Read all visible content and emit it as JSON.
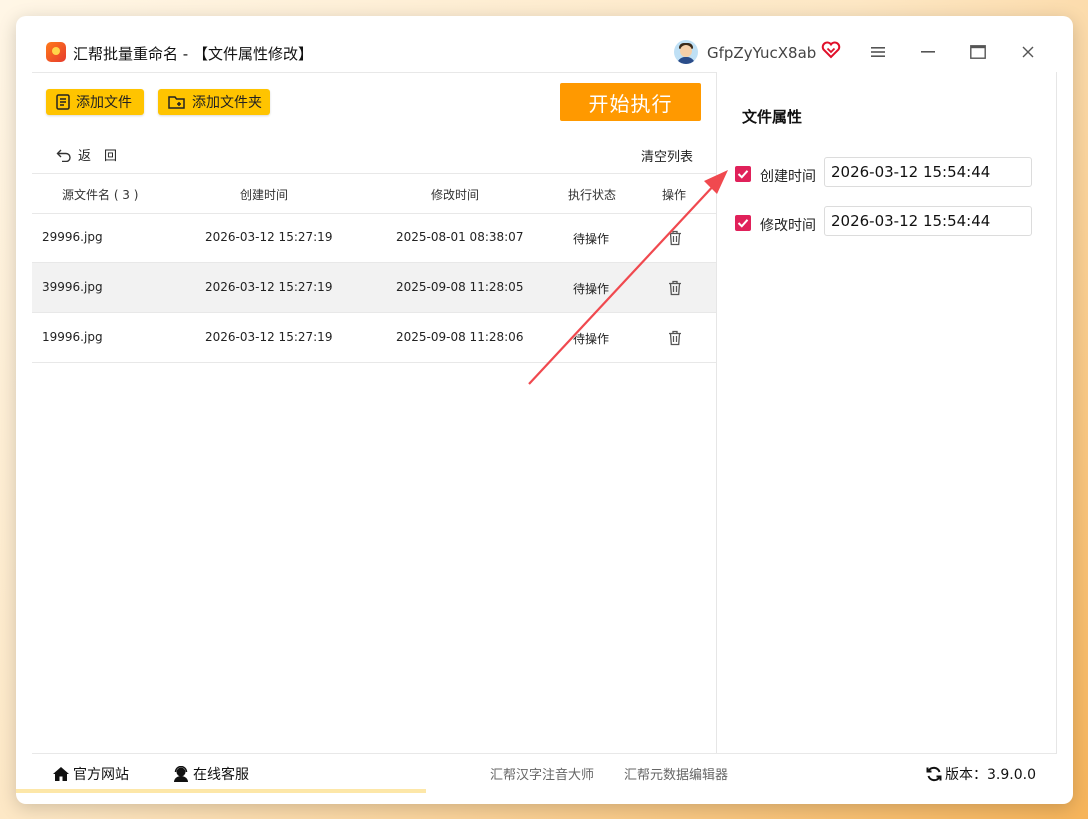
{
  "app": {
    "title": "汇帮批量重命名 - 【文件属性修改】",
    "username": "GfpZyYucX8ab"
  },
  "colors": {
    "accent_yellow": "#ffc400",
    "start_orange": "#ff9900",
    "checkbox": "#e0215a",
    "arrow": "#f0494f"
  },
  "toolbar": {
    "add_file": "添加文件",
    "add_folder": "添加文件夹",
    "start": "开始执行",
    "back": "返　回",
    "clear": "清空列表"
  },
  "table": {
    "headers": {
      "name": "源文件名 ( 3 )",
      "created": "创建时间",
      "modified": "修改时间",
      "status": "执行状态",
      "action": "操作"
    },
    "rows": [
      {
        "name": "29996.jpg",
        "created": "2026-03-12 15:27:19",
        "modified": "2025-08-01 08:38:07",
        "status": "待操作"
      },
      {
        "name": "39996.jpg",
        "created": "2026-03-12 15:27:19",
        "modified": "2025-09-08 11:28:05",
        "status": "待操作"
      },
      {
        "name": "19996.jpg",
        "created": "2026-03-12 15:27:19",
        "modified": "2025-09-08 11:28:06",
        "status": "待操作"
      }
    ]
  },
  "panel": {
    "title": "文件属性",
    "created": {
      "label": "创建时间",
      "checked": true,
      "value": "2026-03-12 15:54:44"
    },
    "modified": {
      "label": "修改时间",
      "checked": true,
      "value": "2026-03-12 15:54:44"
    }
  },
  "footer": {
    "website": "官方网站",
    "support": "在线客服",
    "link1": "汇帮汉字注音大师",
    "link2": "汇帮元数据编辑器",
    "version": "版本：3.9.0.0"
  }
}
